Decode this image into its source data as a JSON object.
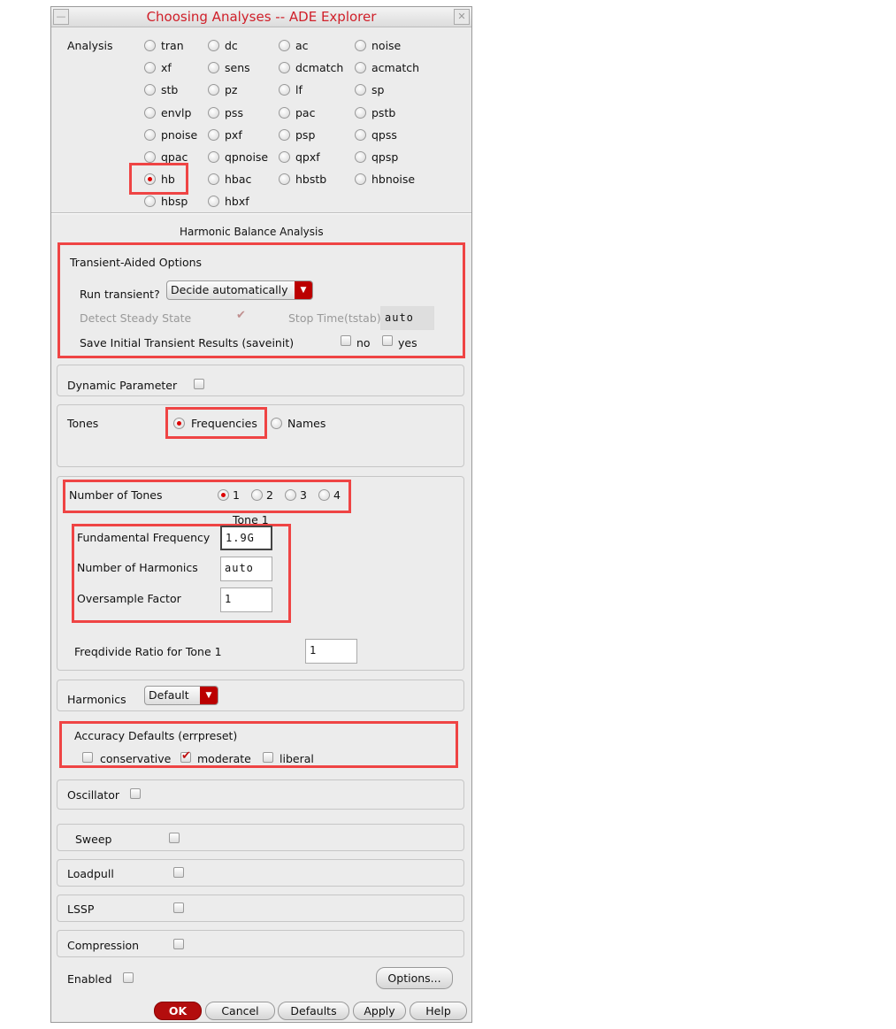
{
  "window": {
    "title": "Choosing Analyses -- ADE Explorer",
    "minimize_icon": "minimize-icon",
    "close_icon": "close-icon"
  },
  "analysis": {
    "label": "Analysis",
    "selected": "hb",
    "options": [
      "tran",
      "dc",
      "ac",
      "noise",
      "xf",
      "sens",
      "dcmatch",
      "acmatch",
      "stb",
      "pz",
      "lf",
      "sp",
      "envlp",
      "pss",
      "pac",
      "pstb",
      "pnoise",
      "pxf",
      "psp",
      "qpss",
      "qpac",
      "qpnoise",
      "qpxf",
      "qpsp",
      "hb",
      "hbac",
      "hbstb",
      "hbnoise",
      "hbsp",
      "hbxf"
    ]
  },
  "section_title": "Harmonic Balance Analysis",
  "transient": {
    "title": "Transient-Aided Options",
    "run_label": "Run transient?",
    "run_value": "Decide automatically",
    "detect_label": "Detect Steady State",
    "detect_checked": true,
    "stop_label": "Stop Time(tstab)",
    "stop_value": "auto",
    "saveinit_label": "Save Initial Transient Results (saveinit)",
    "no_label": "no",
    "yes_label": "yes"
  },
  "dynamic": {
    "label": "Dynamic Parameter"
  },
  "tones": {
    "label": "Tones",
    "freq_label": "Frequencies",
    "names_label": "Names",
    "selected": "Frequencies"
  },
  "num_tones": {
    "label": "Number of Tones",
    "options": [
      "1",
      "2",
      "3",
      "4"
    ],
    "selected": "1",
    "tone_title": "Tone 1",
    "fund_label": "Fundamental Frequency",
    "fund_value": "1.9G",
    "harm_label": "Number of Harmonics",
    "harm_value": "auto",
    "over_label": "Oversample Factor",
    "over_value": "1",
    "freqdiv_label": "Freqdivide Ratio for Tone 1",
    "freqdiv_value": "1"
  },
  "harmonics": {
    "label": "Harmonics",
    "value": "Default"
  },
  "accuracy": {
    "label": "Accuracy Defaults (errpreset)",
    "conservative": "conservative",
    "moderate": "moderate",
    "liberal": "liberal",
    "selected": "moderate"
  },
  "oscillator": {
    "label": "Oscillator"
  },
  "sweep": {
    "label": "Sweep"
  },
  "loadpull": {
    "label": "Loadpull"
  },
  "lssp": {
    "label": "LSSP"
  },
  "compression": {
    "label": "Compression"
  },
  "enabled": {
    "label": "Enabled"
  },
  "buttons": {
    "options": "Options...",
    "ok": "OK",
    "cancel": "Cancel",
    "defaults": "Defaults",
    "apply": "Apply",
    "help": "Help"
  },
  "colors": {
    "accent": "#b30d0d",
    "highlight": "#ef4444",
    "title": "#d0202a"
  }
}
